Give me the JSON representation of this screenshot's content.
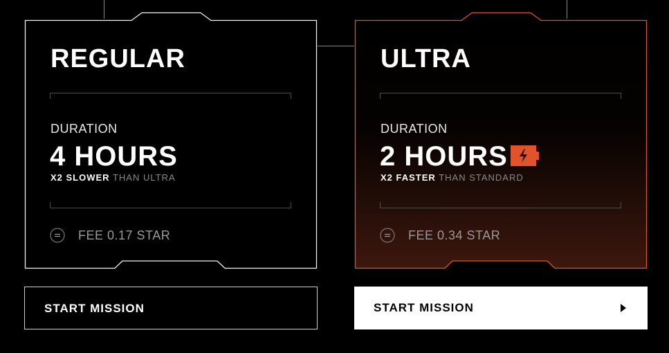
{
  "colors": {
    "background": "#000000",
    "regular_border": "#ffffff",
    "ultra_accent": "#e0532d",
    "ultra_glow": "#3a160e",
    "muted_text": "#8a8a8a"
  },
  "cards": {
    "regular": {
      "title": "REGULAR",
      "duration_label": "DURATION",
      "duration_value": "4 HOURS",
      "compare_strong": "X2 SLOWER",
      "compare_dim": "THAN ULTRA",
      "fee": "FEE 0.17 STAR",
      "fee_icon": "star-token-icon"
    },
    "ultra": {
      "title": "ULTRA",
      "duration_label": "DURATION",
      "duration_value": "2 HOURS",
      "badge_icon": "lightning-battery-icon",
      "compare_strong": "X2 FASTER",
      "compare_dim": "THAN STANDARD",
      "fee": "FEE 0.34 STAR",
      "fee_icon": "star-token-icon"
    }
  },
  "buttons": {
    "regular": {
      "label": "START MISSION"
    },
    "ultra": {
      "label": "START MISSION",
      "icon": "play-arrow-icon"
    }
  }
}
